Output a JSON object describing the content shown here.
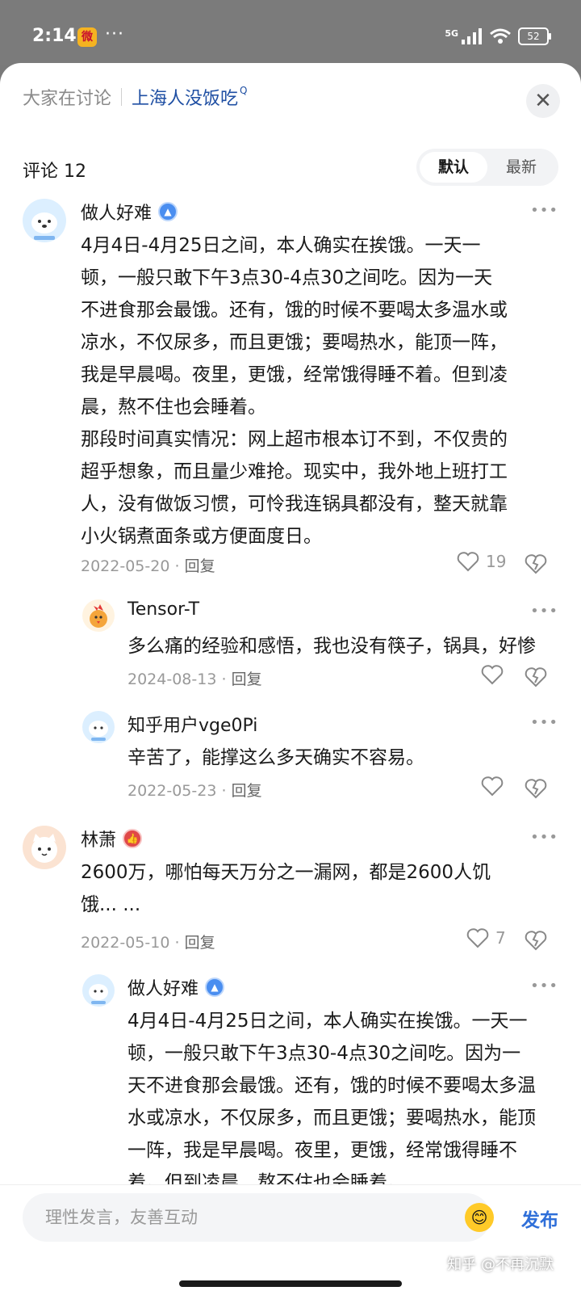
{
  "status": {
    "time": "2:14",
    "dots": "···",
    "network": "5G",
    "battery": "52"
  },
  "header": {
    "topic_label": "大家在讨论",
    "topic_name": "上海人没饭吃",
    "count": "评论 12",
    "sort": [
      "默认",
      "最新"
    ]
  },
  "comments": [
    {
      "user": "做人好难",
      "lines": [
        "4月4日-4月25日之间，本人确实在挨饿。一天一",
        "顿，一般只敢下午3点30-4点30之间吃。因为一天",
        "不进食那会最饿。还有，饿的时候不要喝太多温水或",
        "凉水，不仅尿多，而且更饿；要喝热水，能顶一阵，",
        "我是早晨喝。夜里，更饿，经常饿得睡不着。但到凌",
        "晨，熬不住也会睡着。",
        "那段时间真实情况：网上超市根本订不到，不仅贵的",
        "超乎想象，而且量少难抢。现实中，我外地上班打工",
        "人，没有做饭习惯，可怜我连锅具都没有，整天就靠",
        "小火锅煮面条或方便面度日。"
      ],
      "date": "2022-05-20",
      "reply": "回复",
      "likes": "19"
    },
    {
      "user": "Tensor-T",
      "text": "多么痛的经验和感悟，我也没有筷子，锅具，好惨",
      "date": "2024-08-13",
      "reply": "回复"
    },
    {
      "user": "知乎用户vge0Pi",
      "text": "辛苦了，能撑这么多天确实不容易。",
      "date": "2022-05-23",
      "reply": "回复"
    },
    {
      "user": "林萧",
      "lines": [
        "2600万，哪怕每天万分之一漏网，都是2600人饥",
        "饿... ..."
      ],
      "date": "2022-05-10",
      "reply": "回复",
      "likes": "7"
    },
    {
      "user": "做人好难",
      "lines": [
        "4月4日-4月25日之间，本人确实在挨饿。一天一",
        "顿，一般只敢下午3点30-4点30之间吃。因为一",
        "天不进食那会最饿。还有，饿的时候不要喝太多温",
        "水或凉水，不仅尿多，而且更饿；要喝热水，能顶",
        "一阵，我是早晨喝。夜里，更饿，经常饿得睡不",
        "着。但到凌晨，熬不住也会睡着。"
      ]
    }
  ],
  "bottom": {
    "placeholder": "理性发言，友善互动",
    "publish": "发布",
    "watermark": "知乎 @不再沉默"
  }
}
